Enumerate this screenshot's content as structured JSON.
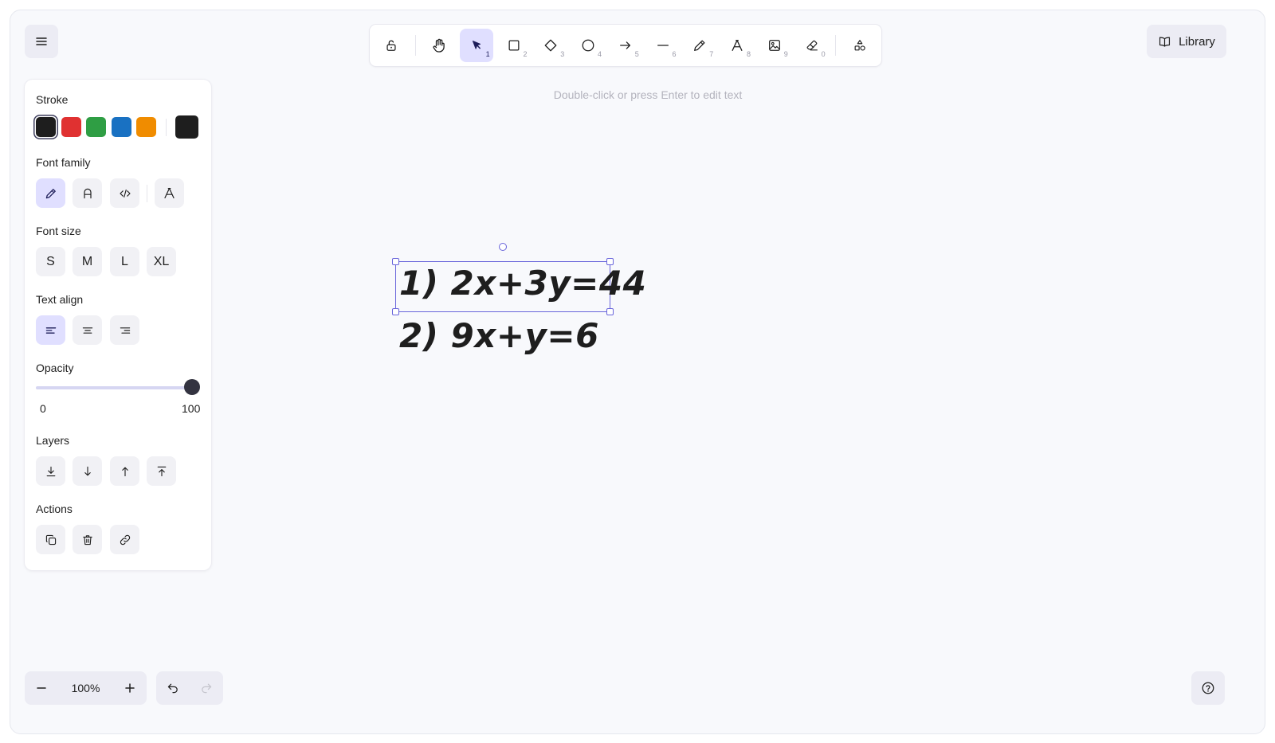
{
  "toolbar": {
    "tools": [
      {
        "name": "lock-tool",
        "key": ""
      },
      {
        "name": "hand-tool",
        "key": ""
      },
      {
        "name": "selection-tool",
        "key": "1"
      },
      {
        "name": "rectangle-tool",
        "key": "2"
      },
      {
        "name": "diamond-tool",
        "key": "3"
      },
      {
        "name": "ellipse-tool",
        "key": "4"
      },
      {
        "name": "arrow-tool",
        "key": "5"
      },
      {
        "name": "line-tool",
        "key": "6"
      },
      {
        "name": "draw-tool",
        "key": "7"
      },
      {
        "name": "text-tool",
        "key": "8"
      },
      {
        "name": "image-tool",
        "key": "9"
      },
      {
        "name": "eraser-tool",
        "key": "0"
      },
      {
        "name": "more-shapes-tool",
        "key": ""
      }
    ],
    "active_tool": "selection-tool"
  },
  "hint": "Double-click or press Enter to edit text",
  "library": {
    "label": "Library"
  },
  "panel": {
    "stroke_title": "Stroke",
    "stroke_colors": [
      "#1e1e1e",
      "#e03131",
      "#2f9e44",
      "#1971c2",
      "#f08c00"
    ],
    "stroke_selected": "#1e1e1e",
    "font_family_title": "Font family",
    "font_size_title": "Font size",
    "font_sizes": [
      "S",
      "M",
      "L",
      "XL"
    ],
    "text_align_title": "Text align",
    "opacity_title": "Opacity",
    "opacity_value": 100,
    "opacity_min": "0",
    "opacity_max": "100",
    "layers_title": "Layers",
    "actions_title": "Actions"
  },
  "canvas": {
    "line1": "1) 2x+3y=44",
    "line2": "2) 9x+y=6"
  },
  "zoom": {
    "value": "100%"
  },
  "colors": {
    "accent": "#6965db",
    "active_bg": "#e0dfff"
  }
}
